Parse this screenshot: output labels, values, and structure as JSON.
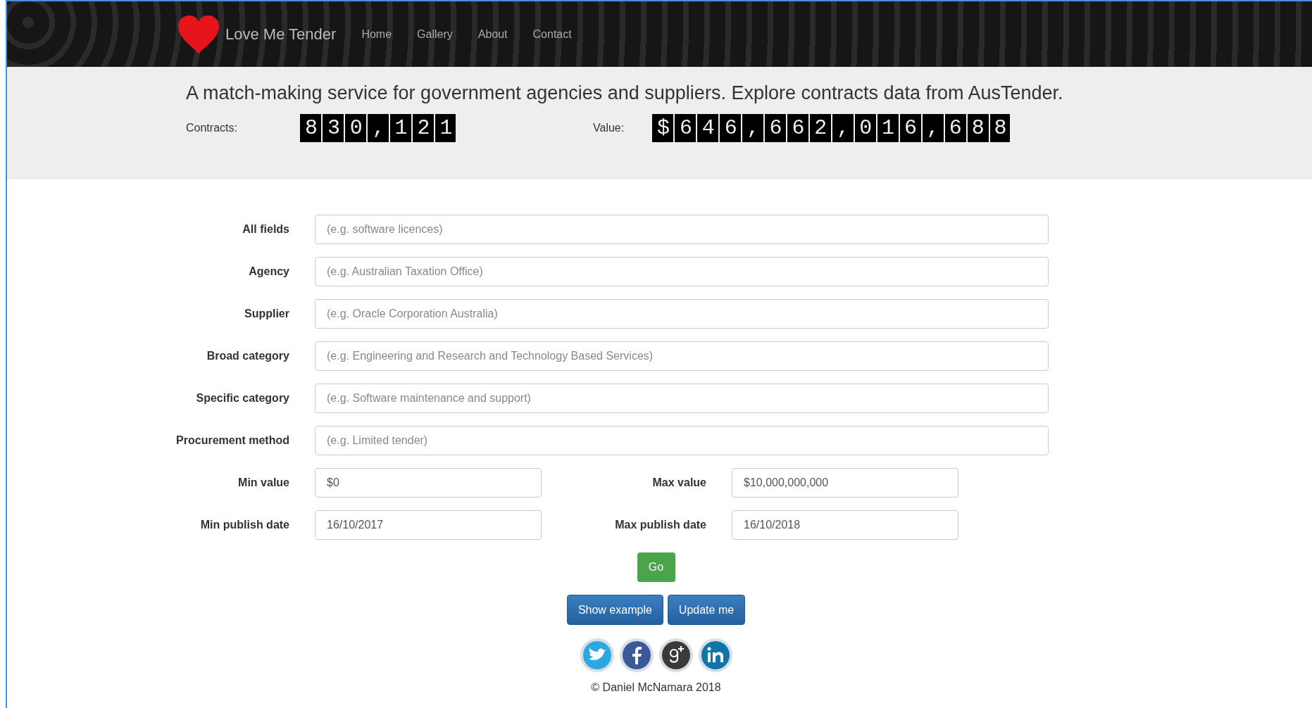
{
  "navbar": {
    "brand": "Love Me Tender",
    "links": [
      {
        "label": "Home"
      },
      {
        "label": "Gallery"
      },
      {
        "label": "About"
      },
      {
        "label": "Contact"
      }
    ]
  },
  "banner": {
    "headline": "A match-making service for government agencies and suppliers. Explore contracts data from AusTender.",
    "counters": [
      {
        "label": "Contracts:",
        "value": "830,121"
      },
      {
        "label": "Value:",
        "value": "$646,662,016,688"
      }
    ]
  },
  "form": {
    "fields": [
      {
        "label": "All fields",
        "placeholder": "(e.g. software licences)"
      },
      {
        "label": "Agency",
        "placeholder": "(e.g. Australian Taxation Office)"
      },
      {
        "label": "Supplier",
        "placeholder": "(e.g. Oracle Corporation Australia)"
      },
      {
        "label": "Broad category",
        "placeholder": "(e.g. Engineering and Research and Technology Based Services)"
      },
      {
        "label": "Specific category",
        "placeholder": "(e.g. Software maintenance and support)"
      },
      {
        "label": "Procurement method",
        "placeholder": "(e.g. Limited tender)"
      }
    ],
    "pairs": [
      [
        {
          "label": "Min value",
          "value": "$0"
        },
        {
          "label": "Max value",
          "value": "$10,000,000,000"
        }
      ],
      [
        {
          "label": "Min publish date",
          "value": "16/10/2017"
        },
        {
          "label": "Max publish date",
          "value": "16/10/2018"
        }
      ]
    ],
    "submit": "Go",
    "buttons": [
      "Show example",
      "Update me"
    ]
  },
  "social": [
    {
      "kind": "twitter"
    },
    {
      "kind": "facebook"
    },
    {
      "kind": "googleplus"
    },
    {
      "kind": "linkedin"
    }
  ],
  "footer": "© Daniel McNamara 2018"
}
